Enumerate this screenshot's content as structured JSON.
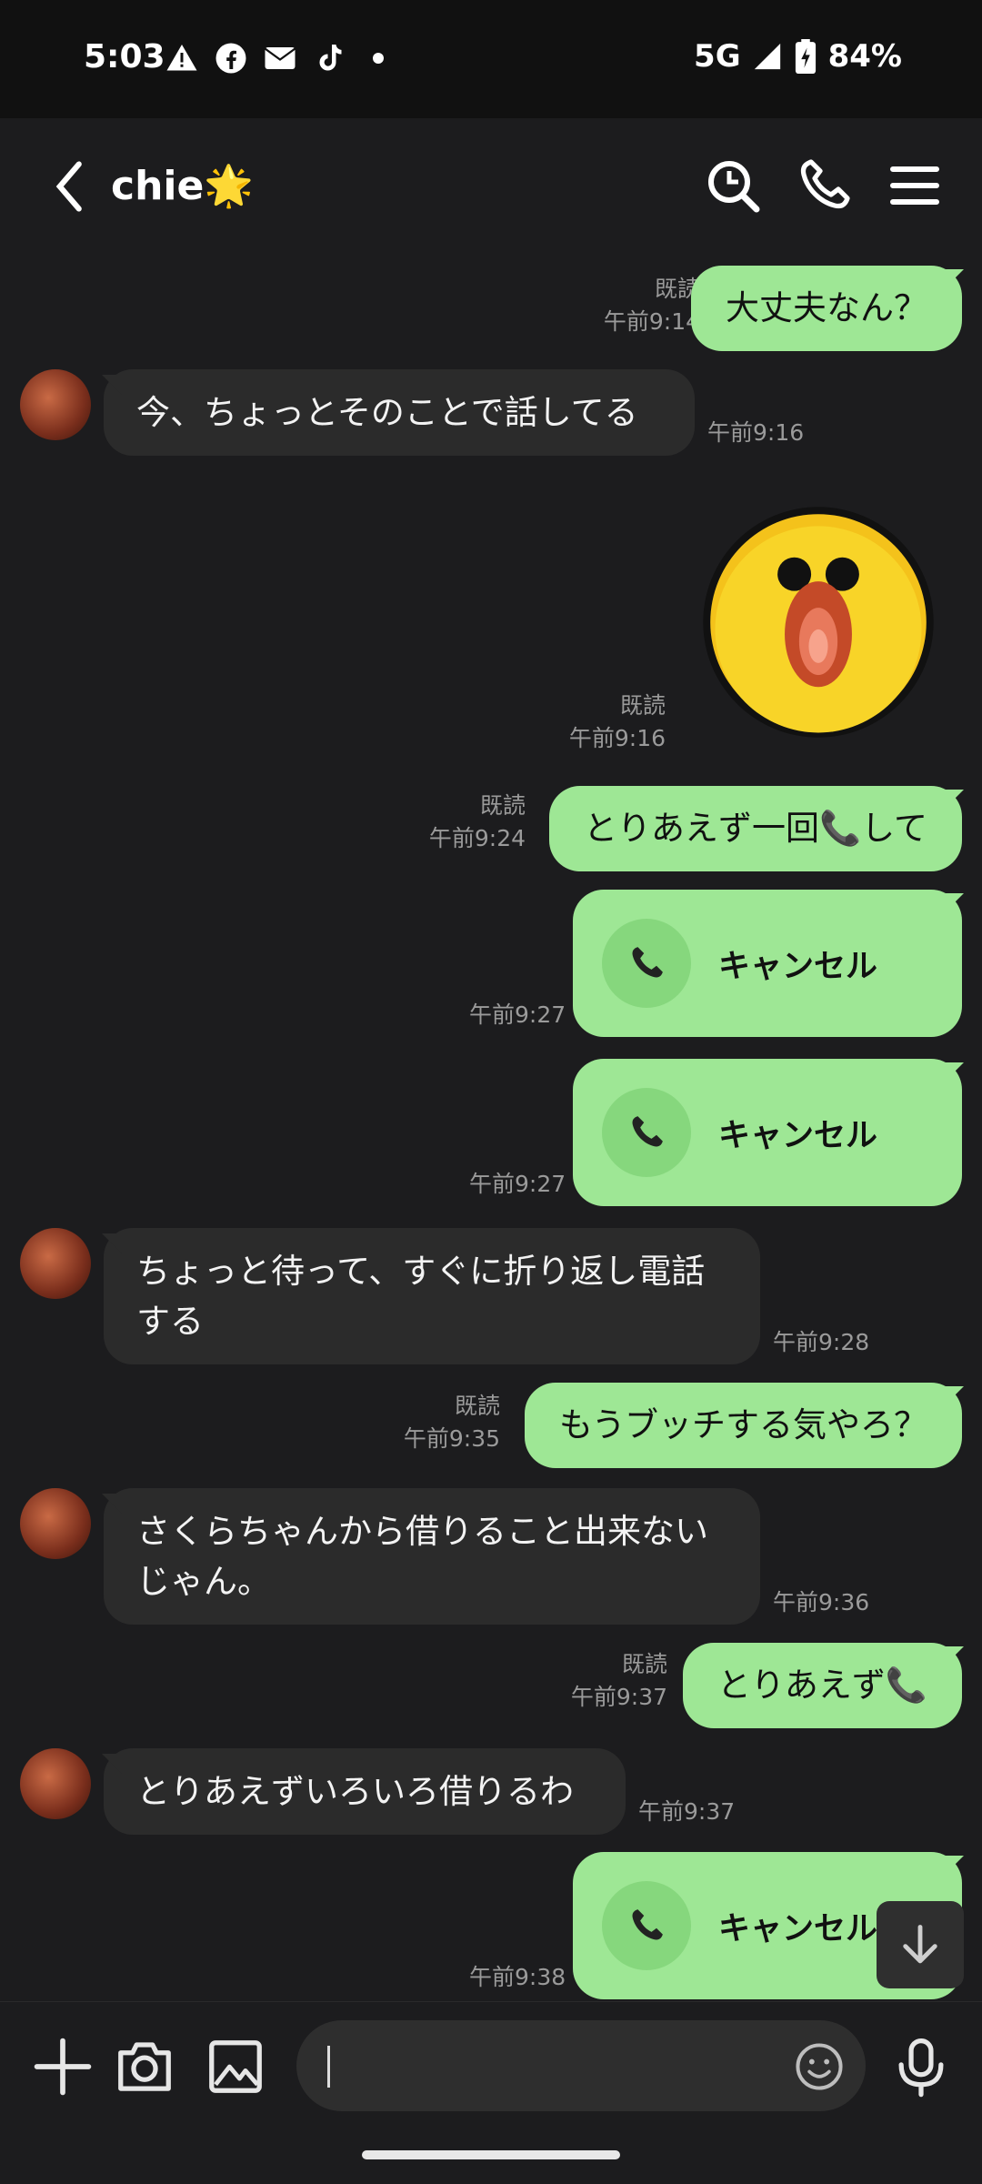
{
  "status_bar": {
    "time": "5:03",
    "network": "5G",
    "battery": "84%",
    "notification_icons": [
      "warning-icon",
      "facebook-icon",
      "au-mail-icon",
      "tiktok-icon",
      "dot-icon"
    ]
  },
  "header": {
    "title": "chie🌟"
  },
  "messages": {
    "m1": {
      "text": "大丈夫なん？",
      "read": "既読",
      "time": "午前9:14"
    },
    "m2": {
      "text": "今、ちょっとそのことで話してる",
      "time": "午前9:16"
    },
    "m3": {
      "read": "既読",
      "time": "午前9:16"
    },
    "m4": {
      "text": "とりあえず一回📞して",
      "read": "既読",
      "time": "午前9:24"
    },
    "m5": {
      "text": "キャンセル",
      "time": "午前9:27"
    },
    "m6": {
      "text": "キャンセル",
      "time": "午前9:27"
    },
    "m7": {
      "text": "ちょっと待って、すぐに折り返し電話する",
      "time": "午前9:28"
    },
    "m8": {
      "text": "もうブッチする気やろ？",
      "read": "既読",
      "time": "午前9:35"
    },
    "m9": {
      "text": "さくらちゃんから借りること出来ないじゃん。",
      "time": "午前9:36"
    },
    "m10": {
      "text": "とりあえず📞",
      "read": "既読",
      "time": "午前9:37"
    },
    "m11": {
      "text": "とりあえずいろいろ借りるわ",
      "time": "午前9:37"
    },
    "m12": {
      "text": "キャンセル",
      "time": "午前9:38"
    }
  },
  "colors": {
    "outgoing_bubble": "#9ee795",
    "incoming_bubble": "#2b2b2b",
    "background": "#1c1c1e"
  }
}
